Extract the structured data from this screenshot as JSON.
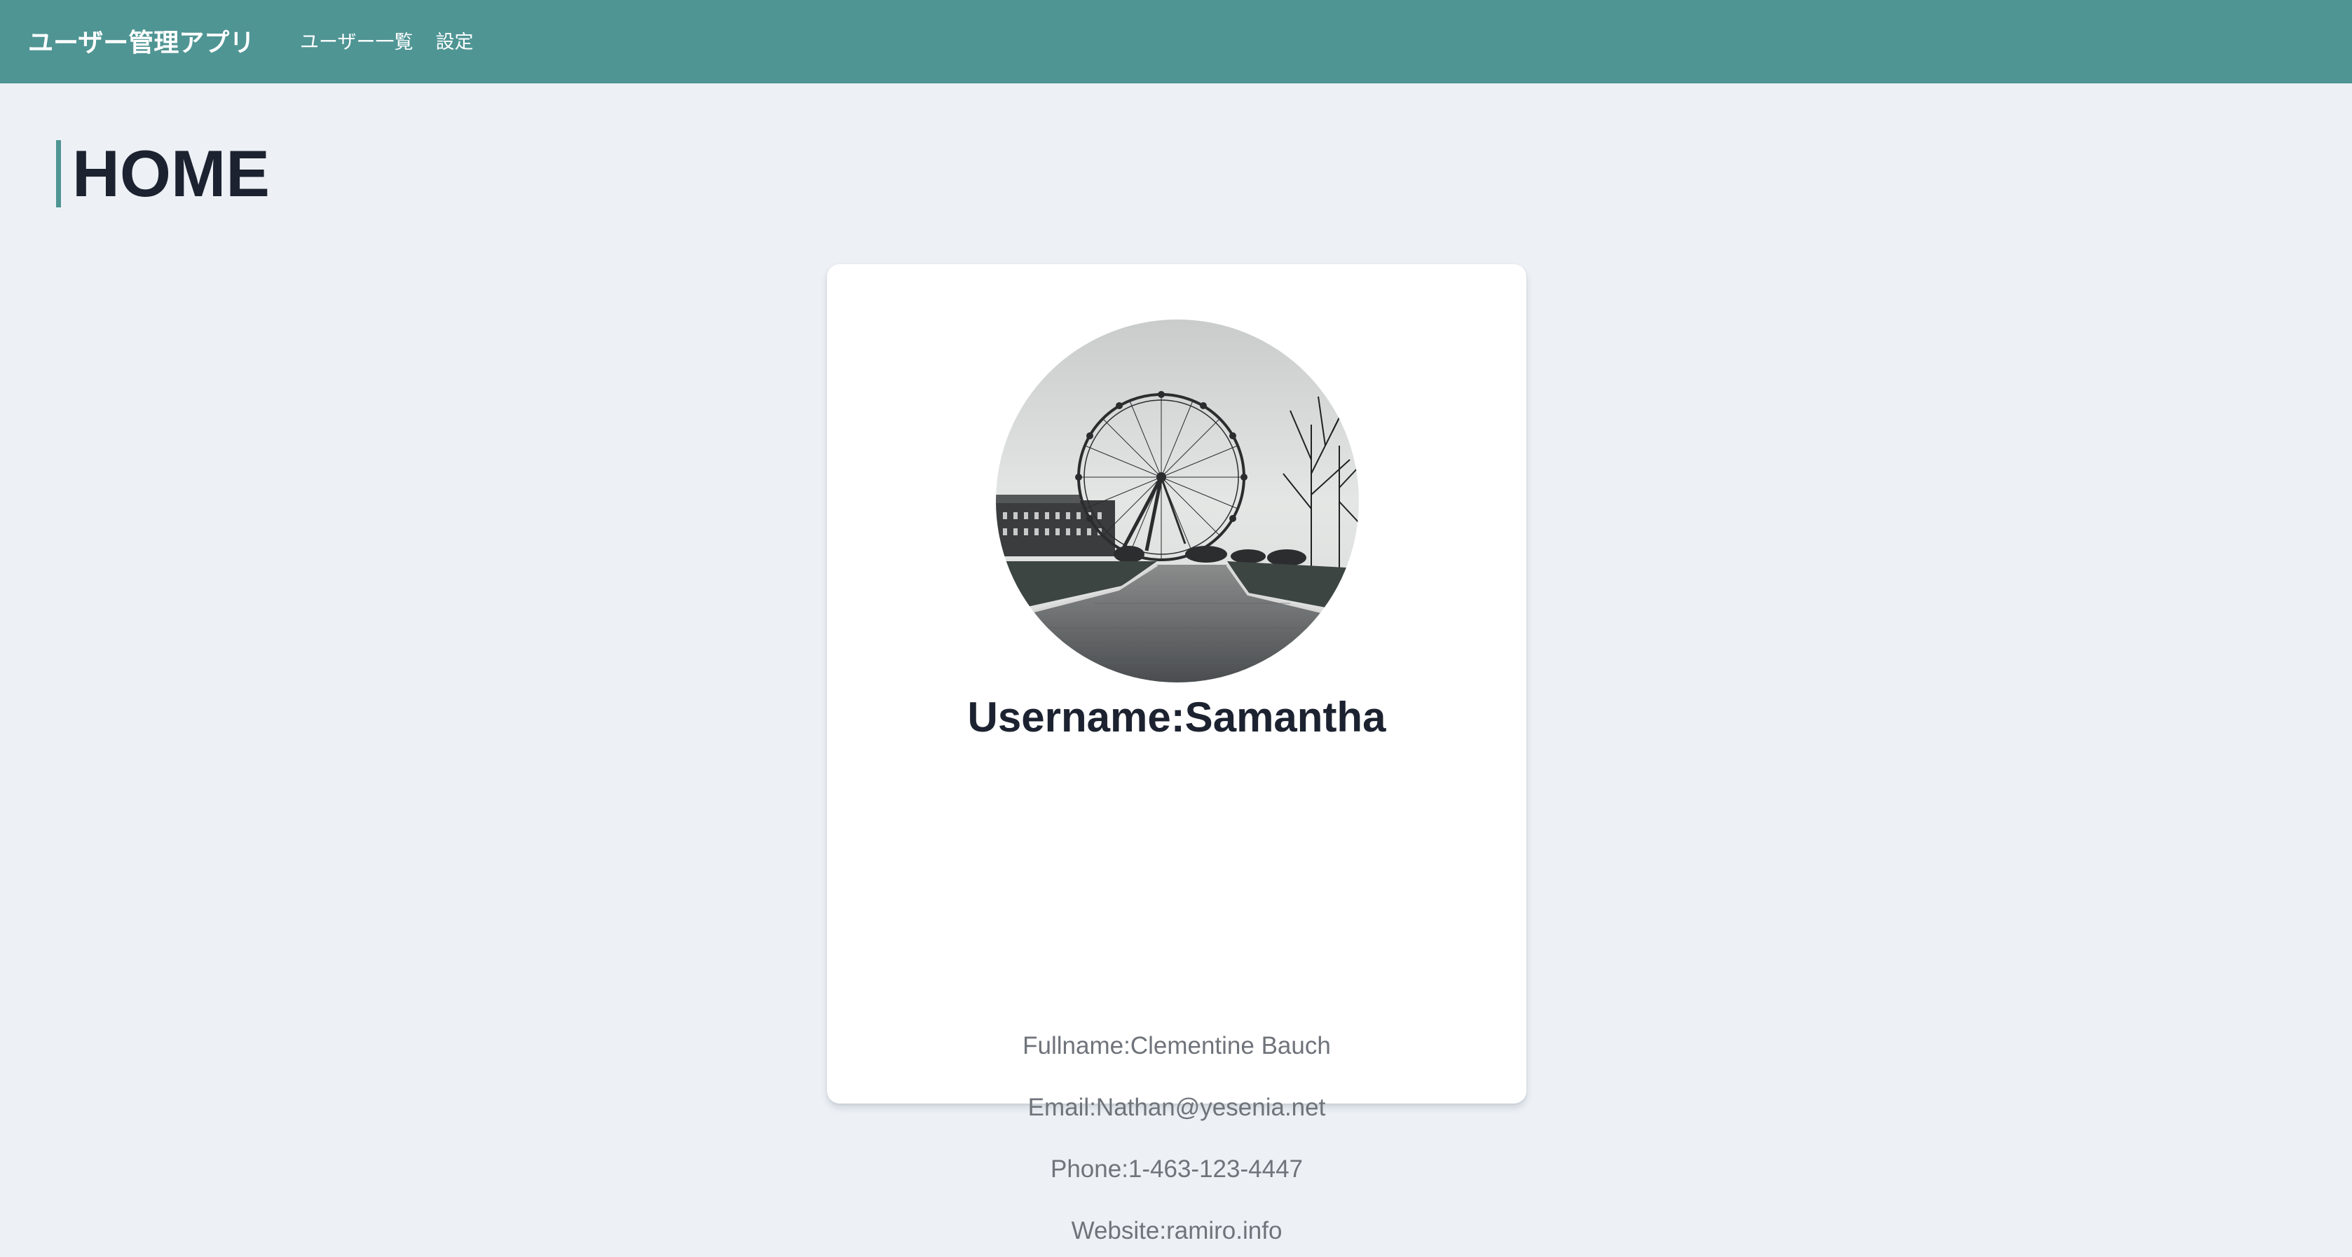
{
  "app": {
    "brand": "ユーザー管理アプリ",
    "accent_color": "#4f9594",
    "background_color": "#edf1f6"
  },
  "nav": {
    "items": [
      {
        "label": "ユーザー一覧"
      },
      {
        "label": "設定"
      }
    ]
  },
  "page": {
    "title": "HOME"
  },
  "profile": {
    "avatar_icon": "ferris-wheel-photo",
    "username": "Username:Samantha",
    "fullname": "Fullname:Clementine Bauch",
    "email": "Email:Nathan@yesenia.net",
    "phone": "Phone:1-463-123-4447",
    "website": "Website:ramiro.info"
  }
}
